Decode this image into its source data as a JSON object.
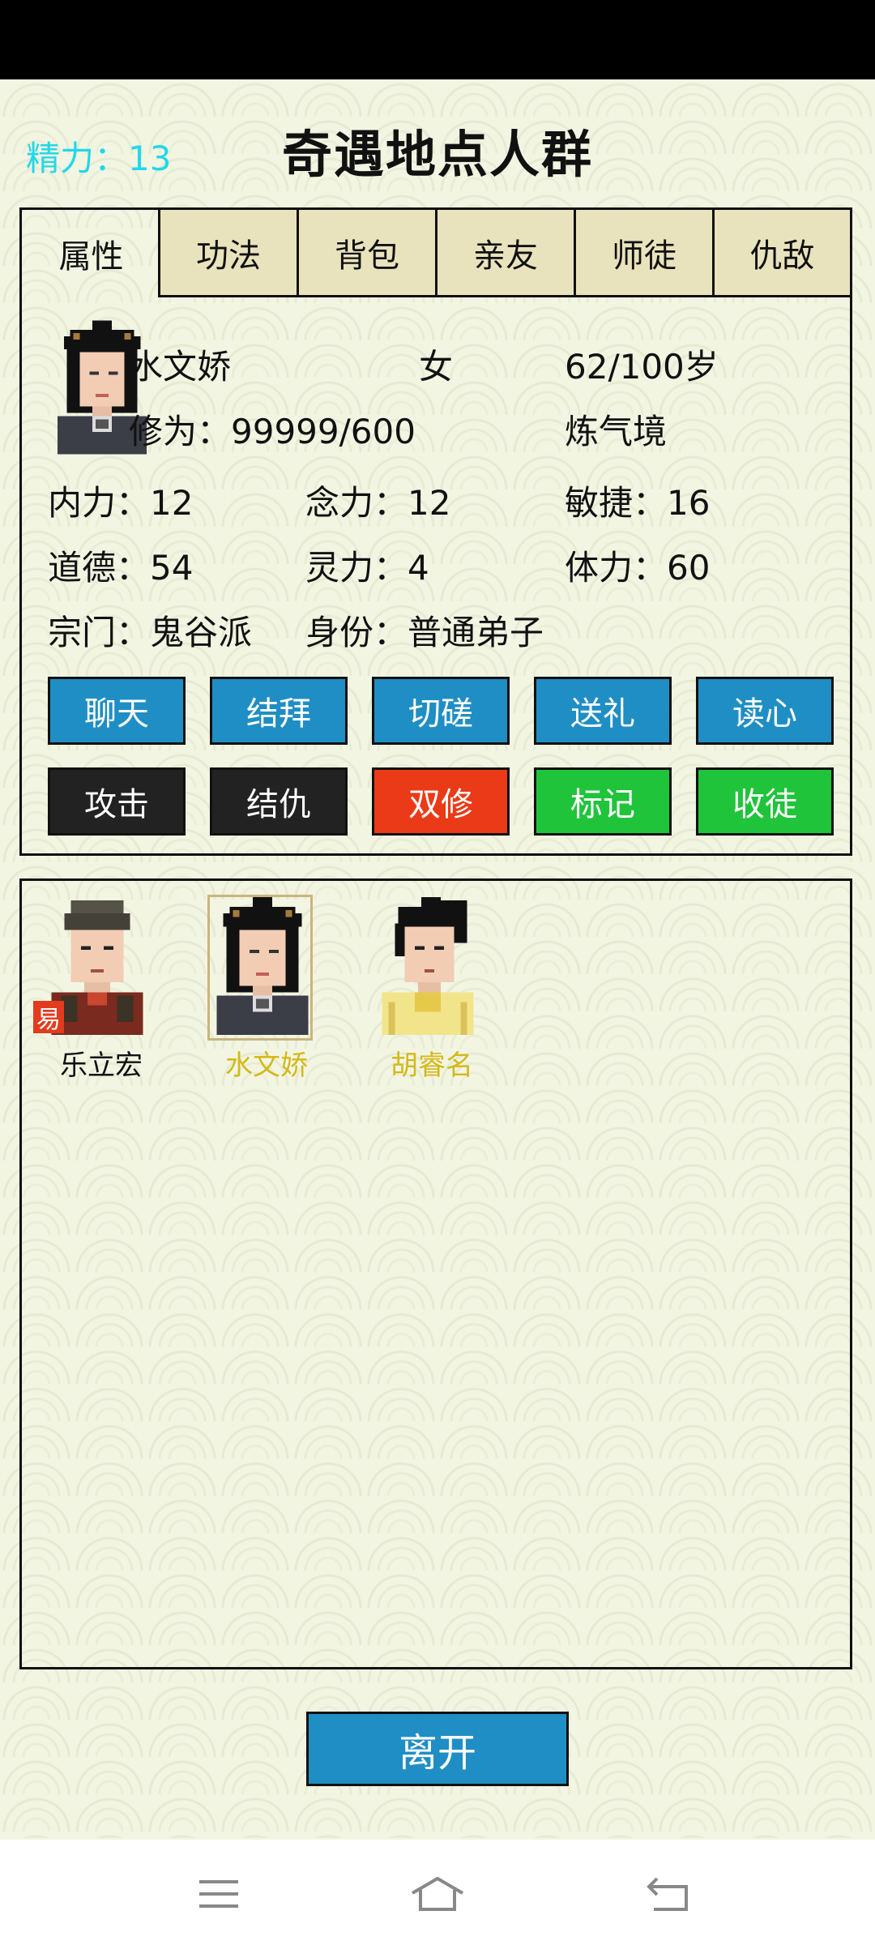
{
  "header": {
    "stamina_text": "精力：13",
    "title": "奇遇地点人群"
  },
  "tabs": [
    {
      "label": "属性",
      "active": true
    },
    {
      "label": "功法"
    },
    {
      "label": "背包"
    },
    {
      "label": "亲友"
    },
    {
      "label": "师徒"
    },
    {
      "label": "仇敌"
    }
  ],
  "character": {
    "name": "水文娇",
    "gender": "女",
    "age": "62/100岁",
    "cultivation": "修为：99999/600",
    "realm": "炼气境",
    "stats": {
      "neili": "内力：12",
      "nianli": "念力：12",
      "minjie": "敏捷：16",
      "daode": "道德：54",
      "lingli": "灵力：4",
      "tili": "体力：60",
      "sect": "宗门：鬼谷派",
      "identity": "身份：普通弟子"
    }
  },
  "actions": {
    "row1": [
      "聊天",
      "结拜",
      "切磋",
      "送礼",
      "读心"
    ],
    "row2": [
      "攻击",
      "结仇",
      "双修",
      "标记",
      "收徒"
    ]
  },
  "crowd": [
    {
      "name": "乐立宏",
      "badge": "易",
      "name_color": "#111111"
    },
    {
      "name": "水文娇",
      "name_color": "#d4b91a",
      "selected": true
    },
    {
      "name": "胡睿名",
      "name_color": "#d4b91a"
    }
  ],
  "leave_label": "离开",
  "colors": {
    "accent_blue": "#1f8ec4",
    "danger_red": "#ea3a17",
    "success_green": "#1fc43a",
    "stamina_cyan": "#22d8e8",
    "highlight_name": "#d4b91a"
  }
}
